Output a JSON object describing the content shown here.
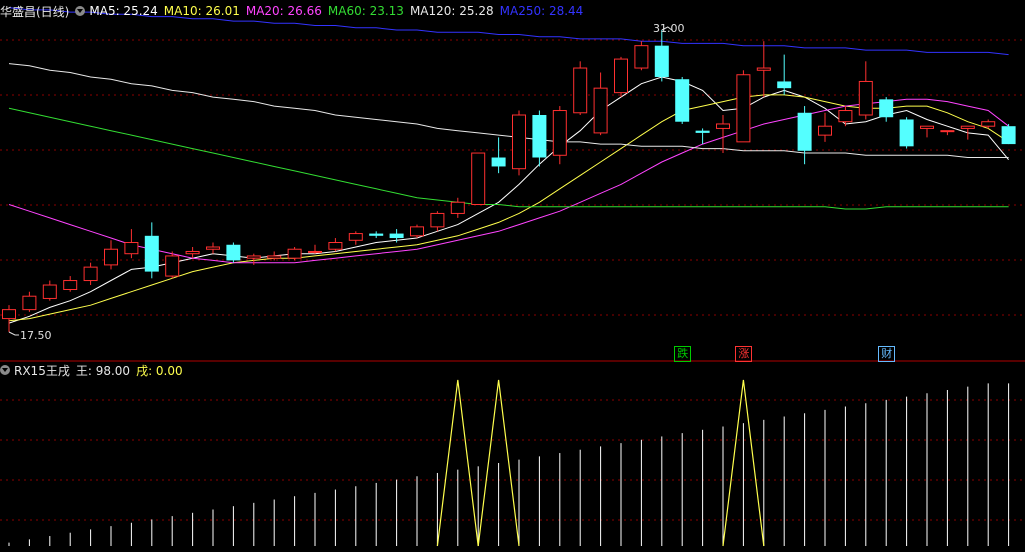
{
  "main": {
    "title": "华盛昌(日线)",
    "ma": [
      {
        "label": "MA5: 25.24",
        "color": "#ffffff"
      },
      {
        "label": "MA10: 26.01",
        "color": "#ffff4d"
      },
      {
        "label": "MA20: 26.66",
        "color": "#ff44ff"
      },
      {
        "label": "MA60: 23.13",
        "color": "#33dd33"
      },
      {
        "label": "MA120: 25.28",
        "color": "#e8e8e8"
      },
      {
        "label": "MA250: 28.44",
        "color": "#3333ff"
      }
    ],
    "high_label": "31.00",
    "low_label": "17.50",
    "events": [
      {
        "text": "跌",
        "color": "#00cc00",
        "index": 33
      },
      {
        "text": "涨",
        "color": "#ff3333",
        "index": 36
      },
      {
        "text": "财",
        "color": "#66bbff",
        "index": 43
      }
    ]
  },
  "sub": {
    "title": "RX15王戌",
    "v1": "王: 98.00",
    "v2": "戌: 0.00",
    "v2_color": "#ffff4d"
  },
  "colors": {
    "up": "#ff3030",
    "down": "#54ffff",
    "grid": "#8b0000"
  },
  "chart_data": {
    "type": "candlestick",
    "price_range": [
      17.5,
      31.0
    ],
    "candles": [
      [
        18.1,
        18.5,
        17.5,
        18.7
      ],
      [
        18.5,
        19.1,
        18.4,
        19.3
      ],
      [
        19.0,
        19.6,
        18.9,
        19.8
      ],
      [
        19.4,
        19.8,
        19.3,
        20.0
      ],
      [
        19.8,
        20.4,
        19.6,
        20.6
      ],
      [
        20.5,
        21.2,
        20.3,
        21.6
      ],
      [
        21.0,
        21.5,
        20.8,
        22.1
      ],
      [
        21.8,
        20.2,
        19.9,
        22.4
      ],
      [
        20.0,
        20.9,
        19.9,
        21.1
      ],
      [
        21.0,
        21.1,
        20.8,
        21.3
      ],
      [
        21.2,
        21.3,
        21.0,
        21.5
      ],
      [
        21.4,
        20.7,
        20.6,
        21.5
      ],
      [
        20.8,
        20.9,
        20.5,
        21.0
      ],
      [
        20.8,
        20.9,
        20.7,
        21.1
      ],
      [
        20.8,
        21.2,
        20.7,
        21.3
      ],
      [
        21.1,
        21.1,
        21.0,
        21.4
      ],
      [
        21.2,
        21.5,
        21.1,
        21.7
      ],
      [
        21.6,
        21.9,
        21.4,
        22.0
      ],
      [
        21.9,
        21.8,
        21.7,
        22.0
      ],
      [
        21.9,
        21.7,
        21.5,
        22.1
      ],
      [
        21.8,
        22.2,
        21.7,
        22.3
      ],
      [
        22.2,
        22.8,
        22.0,
        22.9
      ],
      [
        22.8,
        23.3,
        22.6,
        23.5
      ],
      [
        23.2,
        25.5,
        23.2,
        25.5
      ],
      [
        25.3,
        24.9,
        24.6,
        26.2
      ],
      [
        24.8,
        27.2,
        24.5,
        27.4
      ],
      [
        27.2,
        25.3,
        24.9,
        27.4
      ],
      [
        25.4,
        27.4,
        25.0,
        27.6
      ],
      [
        27.3,
        29.3,
        27.2,
        29.6
      ],
      [
        26.4,
        28.4,
        26.3,
        29.1
      ],
      [
        28.2,
        29.7,
        28.0,
        29.8
      ],
      [
        29.3,
        30.3,
        29.2,
        30.5
      ],
      [
        30.3,
        28.9,
        28.7,
        31.0
      ],
      [
        28.8,
        26.9,
        26.8,
        28.9
      ],
      [
        26.5,
        26.4,
        25.9,
        26.6
      ],
      [
        26.6,
        26.8,
        25.5,
        27.2
      ],
      [
        26.0,
        29.0,
        26.0,
        29.2
      ],
      [
        29.2,
        29.3,
        28.0,
        30.5
      ],
      [
        28.7,
        28.4,
        28.1,
        29.9
      ],
      [
        27.3,
        25.6,
        25.0,
        27.6
      ],
      [
        26.3,
        26.7,
        26.0,
        27.3
      ],
      [
        26.9,
        27.4,
        26.7,
        27.6
      ],
      [
        27.2,
        28.7,
        27.0,
        29.6
      ],
      [
        27.9,
        27.1,
        26.9,
        28.0
      ],
      [
        27.0,
        25.8,
        25.7,
        27.1
      ],
      [
        26.6,
        26.7,
        26.2,
        26.6
      ],
      [
        26.5,
        26.5,
        26.3,
        26.5
      ],
      [
        26.6,
        26.7,
        26.1,
        26.7
      ],
      [
        26.7,
        26.9,
        26.6,
        27.0
      ],
      [
        26.7,
        25.9,
        25.9,
        26.8
      ]
    ],
    "ma_series": [
      {
        "name": "MA5",
        "values": [
          17.9,
          18.2,
          18.6,
          18.9,
          19.3,
          19.8,
          20.3,
          20.4,
          20.6,
          20.8,
          21.0,
          20.9,
          20.8,
          20.9,
          21.0,
          21.0,
          21.1,
          21.3,
          21.5,
          21.6,
          21.7,
          22.0,
          22.3,
          22.8,
          23.3,
          24.1,
          25.0,
          25.8,
          26.5,
          27.4,
          28.0,
          28.6,
          28.9,
          28.7,
          28.3,
          27.4,
          27.5,
          28.0,
          28.3,
          28.0,
          27.5,
          26.8,
          26.9,
          27.2,
          27.4,
          27.0,
          26.7,
          26.4,
          26.3,
          25.2
        ]
      },
      {
        "name": "MA10",
        "values": [
          18.0,
          18.1,
          18.3,
          18.5,
          18.7,
          19.0,
          19.3,
          19.6,
          19.9,
          20.2,
          20.4,
          20.6,
          20.7,
          20.8,
          20.8,
          20.9,
          21.0,
          21.1,
          21.2,
          21.3,
          21.4,
          21.6,
          21.8,
          22.1,
          22.4,
          22.8,
          23.3,
          23.9,
          24.5,
          25.1,
          25.7,
          26.3,
          26.9,
          27.4,
          27.6,
          27.8,
          28.0,
          28.1,
          28.1,
          28.0,
          27.8,
          27.6,
          27.5,
          27.5,
          27.6,
          27.6,
          27.3,
          26.9,
          26.6,
          26.0
        ]
      },
      {
        "name": "MA20",
        "values": [
          23.2,
          22.9,
          22.6,
          22.3,
          22.0,
          21.7,
          21.4,
          21.2,
          21.0,
          20.8,
          20.7,
          20.6,
          20.6,
          20.6,
          20.6,
          20.7,
          20.8,
          20.9,
          21.0,
          21.1,
          21.2,
          21.4,
          21.6,
          21.8,
          22.0,
          22.3,
          22.6,
          22.9,
          23.3,
          23.7,
          24.1,
          24.6,
          25.1,
          25.5,
          25.9,
          26.2,
          26.5,
          26.8,
          27.0,
          27.2,
          27.4,
          27.6,
          27.7,
          27.8,
          27.9,
          27.9,
          27.8,
          27.6,
          27.4,
          26.7
        ]
      },
      {
        "name": "MA60",
        "values": [
          27.5,
          27.3,
          27.1,
          26.9,
          26.7,
          26.5,
          26.3,
          26.1,
          25.9,
          25.7,
          25.5,
          25.3,
          25.1,
          24.9,
          24.7,
          24.5,
          24.3,
          24.1,
          23.9,
          23.7,
          23.5,
          23.4,
          23.3,
          23.2,
          23.2,
          23.1,
          23.1,
          23.1,
          23.1,
          23.1,
          23.1,
          23.1,
          23.1,
          23.1,
          23.1,
          23.1,
          23.1,
          23.1,
          23.1,
          23.1,
          23.1,
          23.0,
          23.0,
          23.1,
          23.1,
          23.1,
          23.1,
          23.1,
          23.1,
          23.1
        ]
      },
      {
        "name": "MA120",
        "values": [
          29.5,
          29.4,
          29.2,
          29.1,
          28.9,
          28.8,
          28.6,
          28.5,
          28.3,
          28.2,
          28.0,
          27.9,
          27.8,
          27.6,
          27.5,
          27.4,
          27.2,
          27.1,
          27.0,
          26.9,
          26.8,
          26.6,
          26.5,
          26.4,
          26.3,
          26.2,
          26.1,
          26.0,
          26.0,
          25.9,
          25.9,
          25.8,
          25.8,
          25.8,
          25.7,
          25.7,
          25.6,
          25.6,
          25.6,
          25.5,
          25.5,
          25.5,
          25.4,
          25.4,
          25.4,
          25.4,
          25.4,
          25.3,
          25.3,
          25.3
        ]
      },
      {
        "name": "MA250",
        "values": [
          32.0,
          31.9,
          31.9,
          31.8,
          31.8,
          31.7,
          31.7,
          31.6,
          31.6,
          31.5,
          31.5,
          31.4,
          31.4,
          31.3,
          31.3,
          31.2,
          31.2,
          31.1,
          31.1,
          31.0,
          31.0,
          30.9,
          30.9,
          30.9,
          30.8,
          30.8,
          30.7,
          30.7,
          30.6,
          30.6,
          30.6,
          30.5,
          30.5,
          30.4,
          30.4,
          30.4,
          30.3,
          30.3,
          30.3,
          30.2,
          30.2,
          30.2,
          30.1,
          30.1,
          30.1,
          30.0,
          30.0,
          30.0,
          30.0,
          29.9
        ]
      }
    ],
    "indicator": {
      "range": [
        0,
        100
      ],
      "values": [
        2,
        4,
        6,
        8,
        10,
        12,
        14,
        16,
        18,
        20,
        22,
        24,
        26,
        28,
        30,
        32,
        34,
        36,
        38,
        40,
        42,
        44,
        46,
        48,
        50,
        52,
        54,
        56,
        58,
        60,
        62,
        64,
        66,
        68,
        70,
        72,
        74,
        76,
        78,
        80,
        82,
        84,
        86,
        88,
        90,
        92,
        94,
        96,
        98,
        98
      ],
      "spikes": [
        22,
        24,
        36
      ]
    }
  }
}
